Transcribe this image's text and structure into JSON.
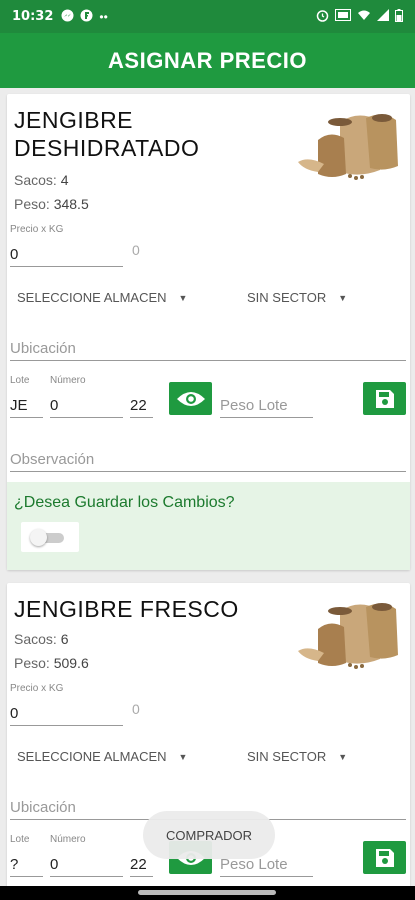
{
  "status_bar": {
    "time": "10:32",
    "left_icons": [
      "messenger-icon",
      "app-f-icon",
      "more-dots-icon"
    ],
    "right_icons": [
      "alarm-icon",
      "vpn-icon",
      "wifi-icon",
      "signal-icon",
      "battery-icon"
    ]
  },
  "header": {
    "title": "ASIGNAR PRECIO"
  },
  "cards": [
    {
      "title": "JENGIBRE DESHIDRATADO",
      "sacos_label": "Sacos:",
      "sacos_value": "4",
      "peso_label": "Peso:",
      "peso_value": "348.5",
      "price_label": "Precio x KG",
      "price_value": "0",
      "price_hint": "0",
      "almacen": "SELECCIONE ALMACEN",
      "sector": "SIN SECTOR",
      "ubicacion_placeholder": "Ubicación",
      "lote_label": "Lote",
      "lote_value": "JE",
      "numero_label": "Número",
      "numero_value": "0",
      "third_value": "22",
      "peso_lote_placeholder": "Peso Lote",
      "observacion_placeholder": "Observación",
      "confirm_question": "¿Desea Guardar los Cambios?",
      "toggle_on": false
    },
    {
      "title": "JENGIBRE FRESCO",
      "sacos_label": "Sacos:",
      "sacos_value": "6",
      "peso_label": "Peso:",
      "peso_value": "509.6",
      "price_label": "Precio x KG",
      "price_value": "0",
      "price_hint": "0",
      "almacen": "SELECCIONE ALMACEN",
      "sector": "SIN SECTOR",
      "ubicacion_placeholder": "Ubicación",
      "lote_label": "Lote",
      "lote_value": "?",
      "numero_label": "Número",
      "numero_value": "0",
      "third_value": "22",
      "peso_lote_placeholder": "Peso Lote"
    }
  ],
  "toast": {
    "text": "COMPRADOR"
  },
  "colors": {
    "primary": "#1f9a40",
    "status_bar": "#1f8a3c",
    "confirm_bg": "#e6f4e6"
  }
}
